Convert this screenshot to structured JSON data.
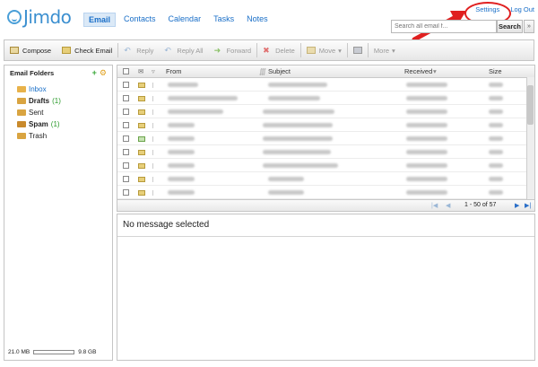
{
  "app": {
    "brand": "Jimdo"
  },
  "nav": {
    "tabs": [
      {
        "label": "Email",
        "active": true
      },
      {
        "label": "Contacts"
      },
      {
        "label": "Calendar"
      },
      {
        "label": "Tasks"
      },
      {
        "label": "Notes"
      }
    ]
  },
  "toplinks": {
    "settings": "Settings",
    "logout": "Log Out"
  },
  "search": {
    "placeholder": "Search all email f...",
    "button": "Search"
  },
  "toolbar": {
    "compose": "Compose",
    "check": "Check Email",
    "reply": "Reply",
    "reply_all": "Reply All",
    "forward": "Forward",
    "delete": "Delete",
    "move": "Move",
    "more": "More"
  },
  "sidebar": {
    "title": "Email Folders",
    "folders": [
      {
        "label": "Inbox",
        "count": "",
        "color": "#e8b24a"
      },
      {
        "label": "Drafts",
        "count": "(1)",
        "color": "#d9a441"
      },
      {
        "label": "Sent",
        "count": "",
        "color": "#d9a441"
      },
      {
        "label": "Spam",
        "count": "(1)",
        "color": "#c98a2c"
      },
      {
        "label": "Trash",
        "count": "",
        "color": "#d9a441"
      }
    ],
    "quota_used": "21.0 MB",
    "quota_total": "9.8 GB"
  },
  "list": {
    "headers": {
      "from": "From",
      "subject": "Subject",
      "received": "Received",
      "size": "Size"
    },
    "pager": "1 - 50 of 57"
  },
  "preview": {
    "empty": "No message selected"
  },
  "colors": {
    "accent": "#1a6fc8",
    "annotation": "#e02020"
  }
}
